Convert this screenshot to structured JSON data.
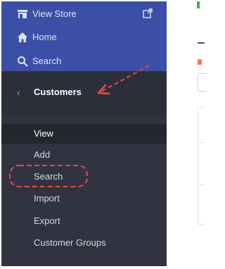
{
  "top_nav": {
    "view_store_label": "View Store",
    "home_label": "Home",
    "search_label": "Search"
  },
  "customers": {
    "title": "Customers",
    "items": [
      {
        "label": "View",
        "active": true
      },
      {
        "label": "Add",
        "active": false
      },
      {
        "label": "Search",
        "active": false
      },
      {
        "label": "Import",
        "active": false
      },
      {
        "label": "Export",
        "active": false
      },
      {
        "label": "Customer Groups",
        "active": false
      }
    ]
  },
  "colors": {
    "sidebar_bg": "#313440",
    "top_nav_bg": "#3c4fa6",
    "annotation": "#e84a4a"
  },
  "icons": [
    "store-icon",
    "external-link-icon",
    "home-icon",
    "search-icon",
    "chevron-left-icon"
  ]
}
